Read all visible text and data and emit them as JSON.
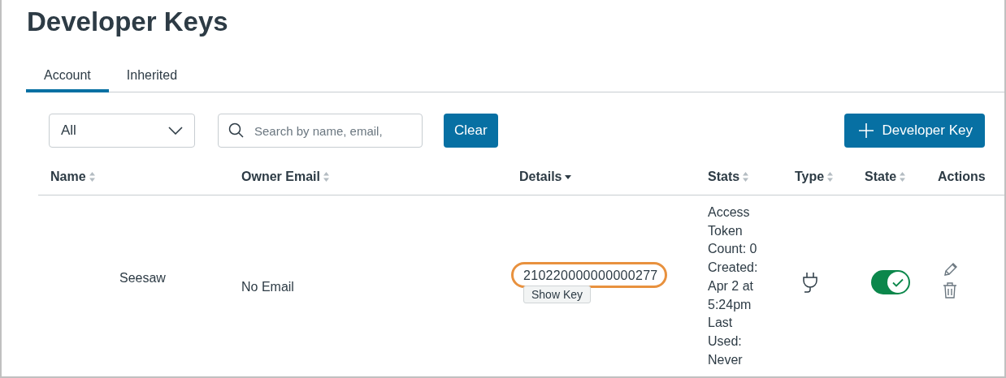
{
  "title": "Developer Keys",
  "tabs": [
    {
      "label": "Account",
      "selected": true
    },
    {
      "label": "Inherited",
      "selected": false
    }
  ],
  "filter": {
    "value": "All"
  },
  "search": {
    "placeholder": "Search by name, email,"
  },
  "clear_button": "Clear",
  "add_button": "Developer Key",
  "table": {
    "columns": [
      {
        "label": "Name",
        "sortable": true,
        "sorted": false
      },
      {
        "label": "Owner Email",
        "sortable": true,
        "sorted": false
      },
      {
        "label": "Details",
        "sortable": true,
        "sorted": true
      },
      {
        "label": "Stats",
        "sortable": true,
        "sorted": false
      },
      {
        "label": "Type",
        "sortable": true,
        "sorted": false
      },
      {
        "label": "State",
        "sortable": true,
        "sorted": false
      },
      {
        "label": "Actions",
        "sortable": false
      }
    ],
    "rows": [
      {
        "name": "Seesaw",
        "owner_email": "No Email",
        "key": "210220000000000277",
        "highlighted": true,
        "show_key": "Show Key",
        "stats": [
          "Access",
          "Token",
          "Count: 0",
          "Created:",
          "Apr 2 at",
          "5:24pm",
          "Last",
          "Used:",
          "Never"
        ],
        "state_on": true
      }
    ]
  }
}
